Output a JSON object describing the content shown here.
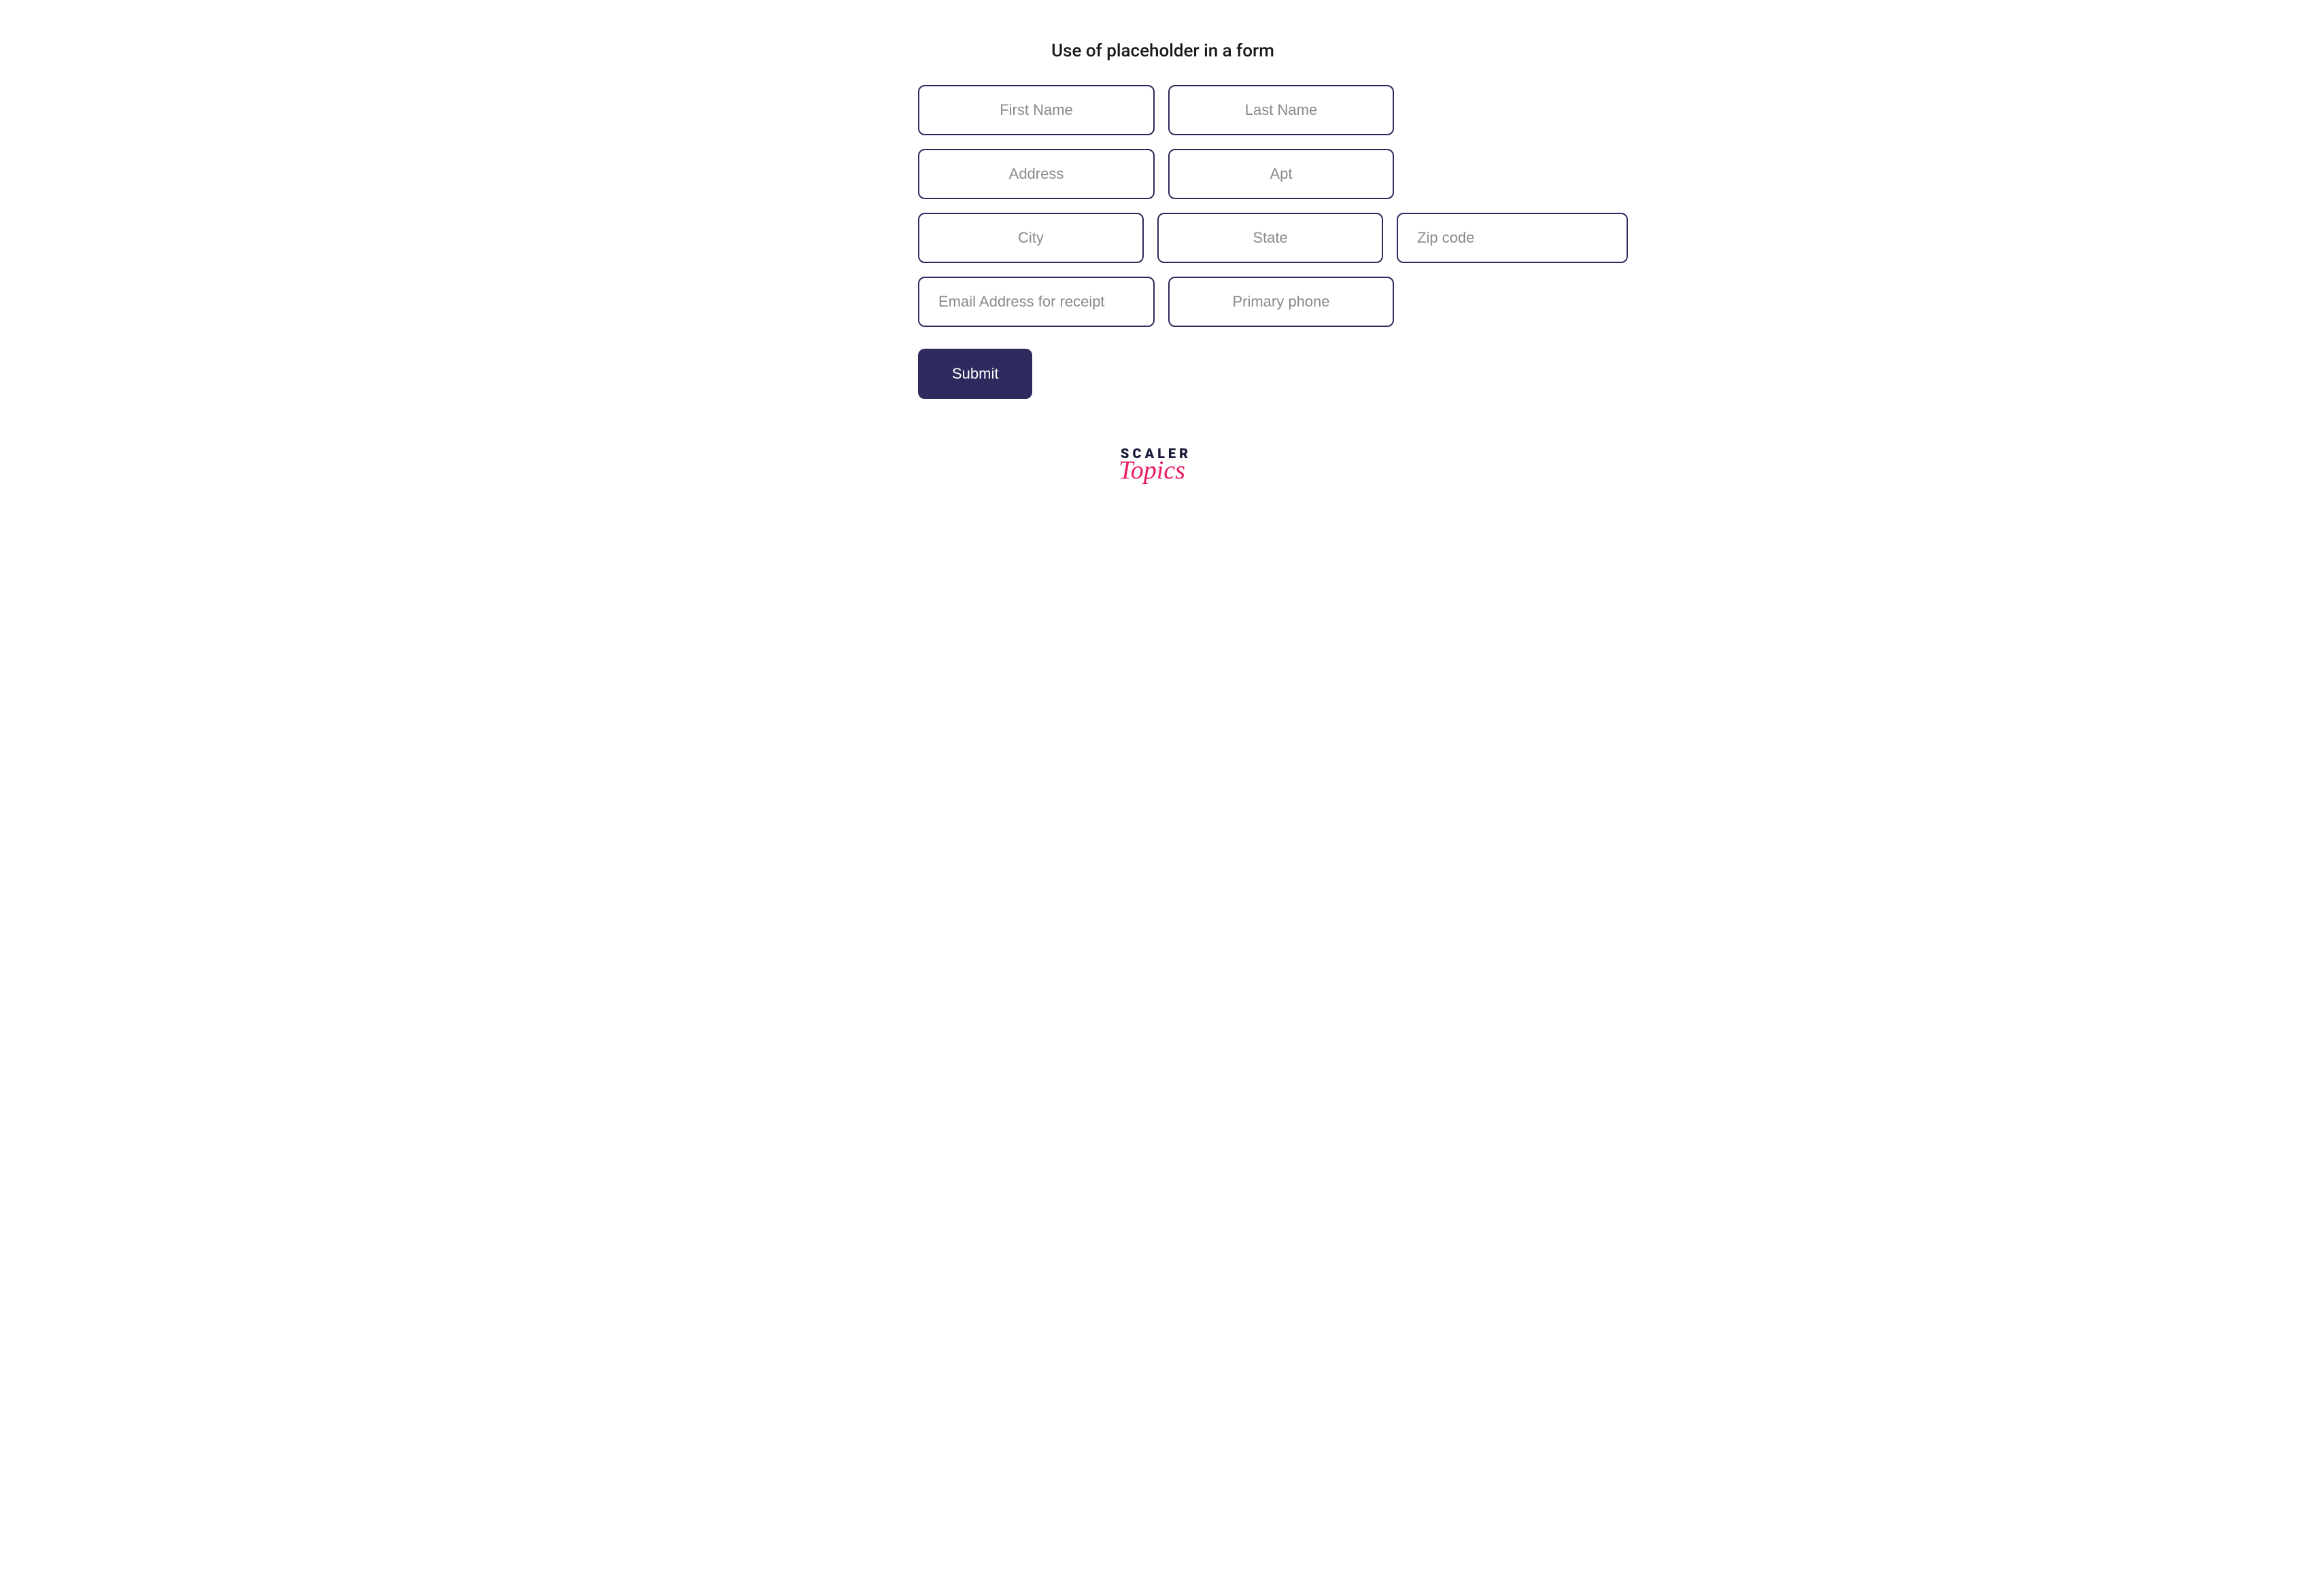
{
  "heading": "Use of placeholder in a form",
  "form": {
    "firstName": {
      "placeholder": "First Name"
    },
    "lastName": {
      "placeholder": "Last Name"
    },
    "address": {
      "placeholder": "Address"
    },
    "apt": {
      "placeholder": "Apt"
    },
    "city": {
      "placeholder": "City"
    },
    "state": {
      "placeholder": "State"
    },
    "zip": {
      "placeholder": "Zip code"
    },
    "email": {
      "placeholder": "Email Address for receipt"
    },
    "phone": {
      "placeholder": "Primary phone"
    },
    "submit_label": "Submit"
  },
  "logo": {
    "line1": "SCALER",
    "line2": "Topics"
  },
  "colors": {
    "border": "#2d2a5e",
    "button_bg": "#2d2a5e",
    "button_text": "#ffffff",
    "placeholder": "#8a8a8a",
    "logo_pink": "#e91e63",
    "logo_dark": "#1a1a3a"
  }
}
